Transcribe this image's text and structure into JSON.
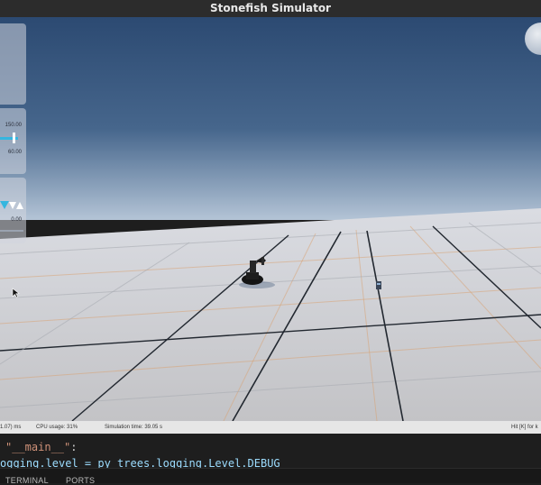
{
  "window": {
    "title": "Stonefish Simulator"
  },
  "overlay": {
    "slider_max": "150.00",
    "slider_min": "60.00",
    "value_readout": "0.00"
  },
  "status_bar": {
    "frame_time": "1.07) ms",
    "cpu_usage": "CPU usage: 31%",
    "simulation_time": "Simulation time: 39.05 s",
    "help_hint": "Hit [K] for k"
  },
  "editor": {
    "line1": {
      "main_string": "\"__main__\"",
      "colon": ":"
    },
    "line2": "ogging.level = py_trees.logging.Level.DEBUG"
  },
  "bottom_panel": {
    "tabs": [
      {
        "label": "TERMINAL"
      },
      {
        "label": "PORTS"
      }
    ]
  },
  "colors": {
    "sky_top": "#2c4a72",
    "sky_horizon": "#b4c4d6",
    "floor": "#c9c9cc",
    "grid_major": "#222830",
    "grid_minor": "#d9a06e",
    "slider_accent": "#35b6df",
    "string_literal": "#ce9178"
  }
}
